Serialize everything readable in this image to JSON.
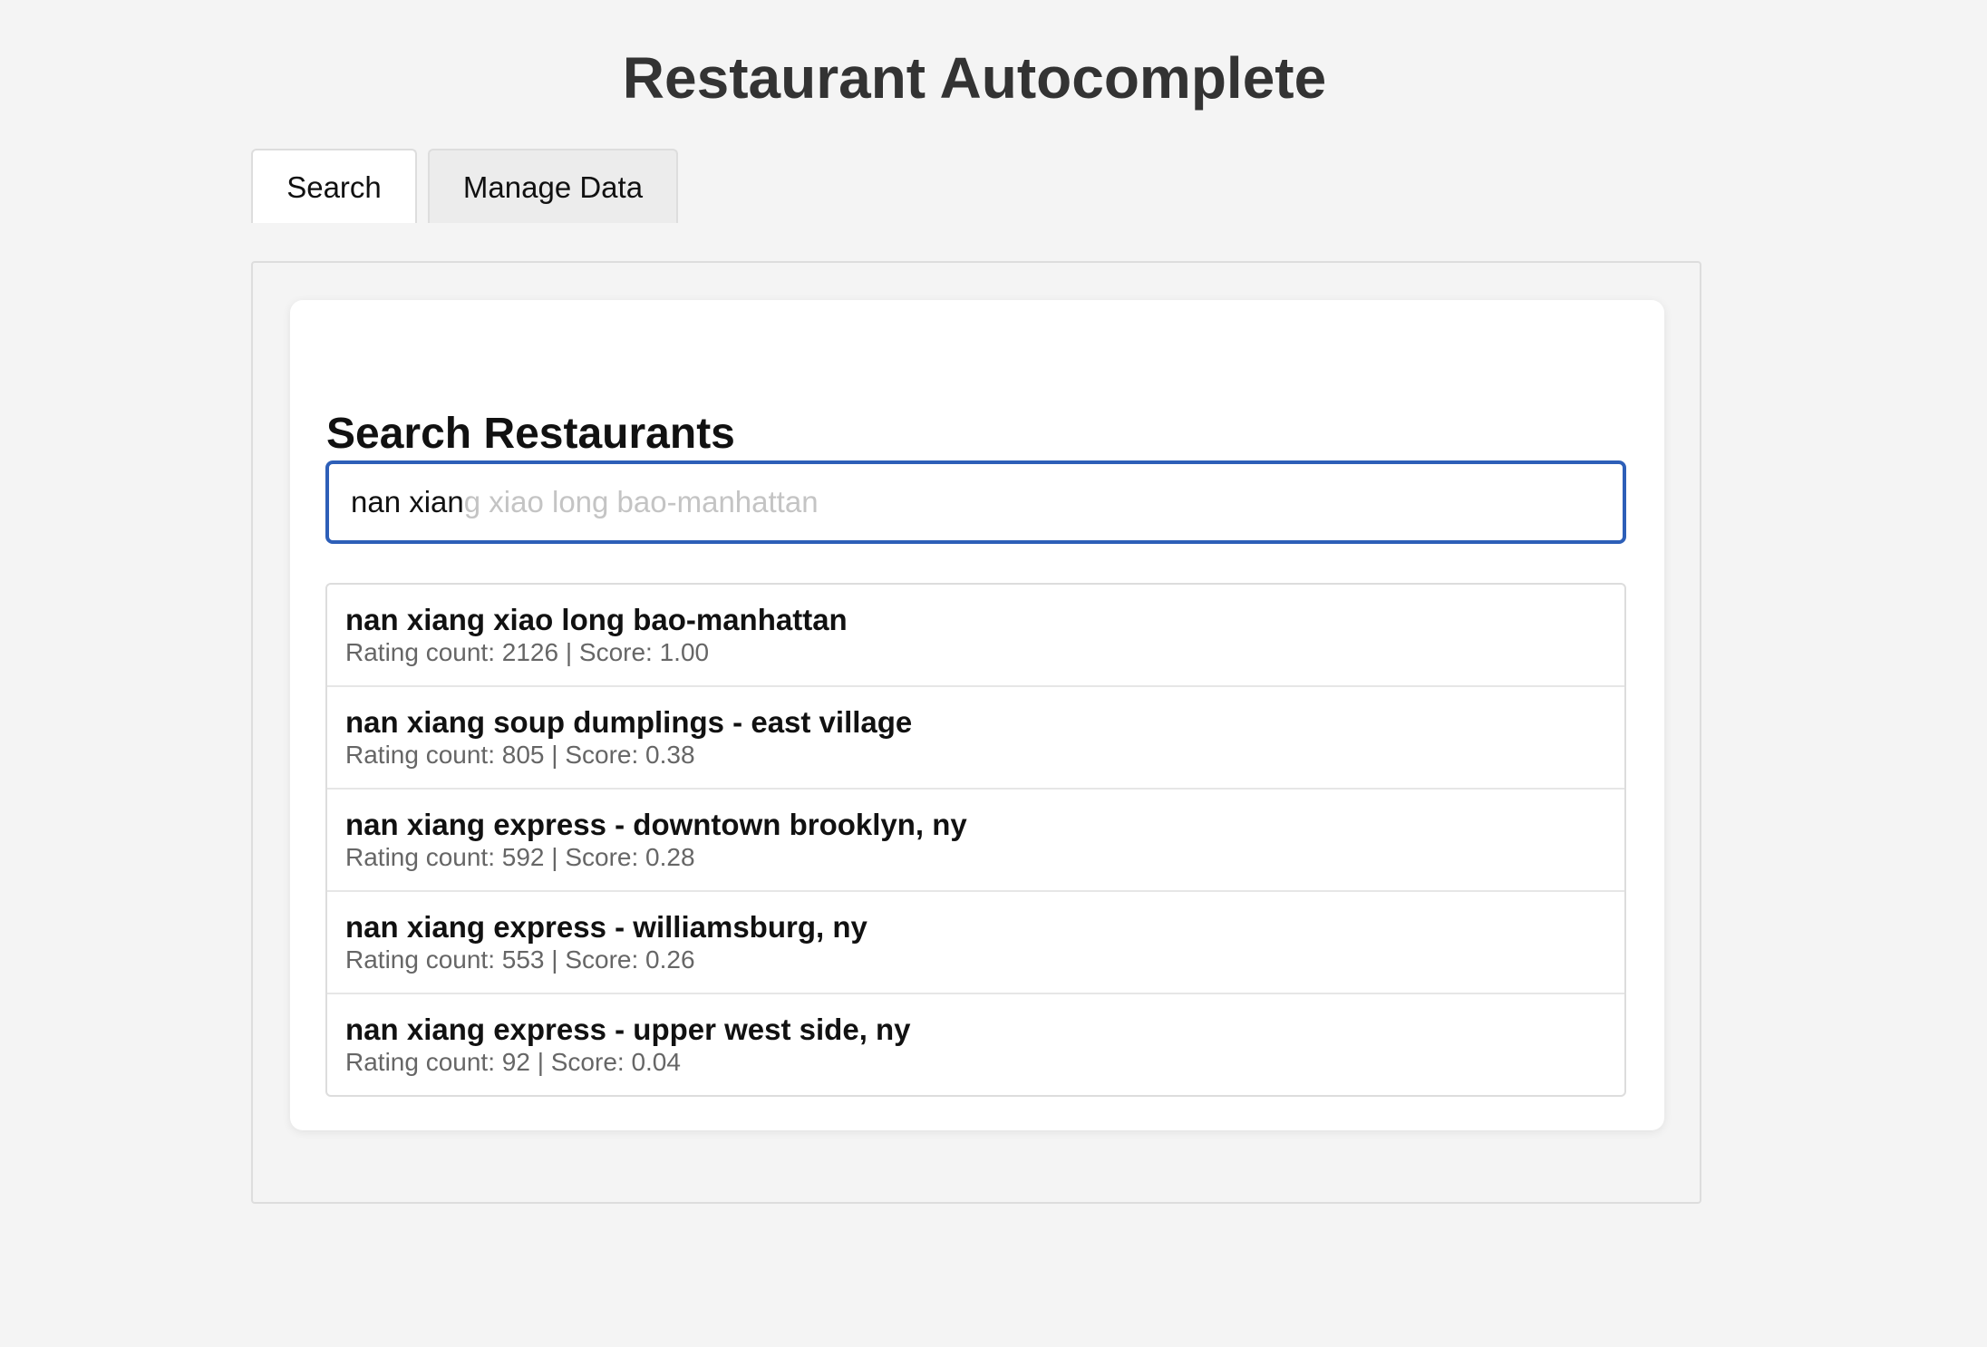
{
  "header": {
    "title": "Restaurant Autocomplete"
  },
  "tabs": [
    {
      "label": "Search",
      "active": true
    },
    {
      "label": "Manage Data",
      "active": false
    }
  ],
  "search_panel": {
    "title": "Search Restaurants",
    "input": {
      "typed_value": "nan xian",
      "autocomplete_suggestion": "g xiao long bao-manhattan"
    },
    "results": [
      {
        "name": "nan xiang xiao long bao-manhattan",
        "meta": "Rating count: 2126 | Score: 1.00"
      },
      {
        "name": "nan xiang soup dumplings - east village",
        "meta": "Rating count: 805 | Score: 0.38"
      },
      {
        "name": "nan xiang express - downtown brooklyn, ny",
        "meta": "Rating count: 592 | Score: 0.28"
      },
      {
        "name": "nan xiang express - williamsburg, ny",
        "meta": "Rating count: 553 | Score: 0.26"
      },
      {
        "name": "nan xiang express - upper west side, ny",
        "meta": "Rating count: 92 | Score: 0.04"
      }
    ]
  },
  "colors": {
    "background": "#f4f4f4",
    "accent_border": "#2d5fb8",
    "title_text": "#333333",
    "meta_text": "#666666",
    "ghost_text": "#c4c4c4"
  }
}
